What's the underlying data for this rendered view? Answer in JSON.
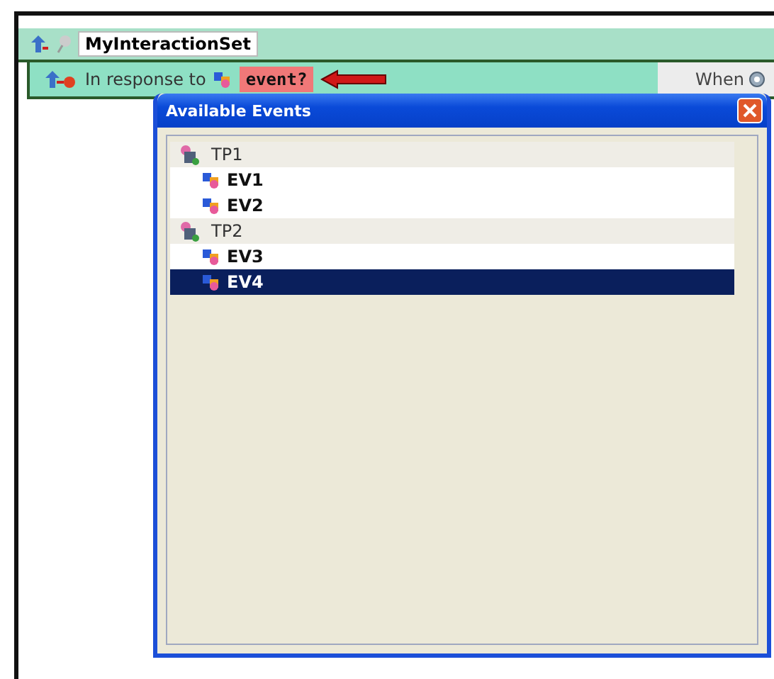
{
  "set": {
    "title": "MyInteractionSet"
  },
  "rule": {
    "prefix": "In response to",
    "event": "event?",
    "when": "When"
  },
  "dialog": {
    "title": "Available Events",
    "groups": [
      {
        "label": "TP1",
        "children": [
          {
            "label": "EV1",
            "selected": false
          },
          {
            "label": "EV2",
            "selected": false
          }
        ]
      },
      {
        "label": "TP2",
        "children": [
          {
            "label": "EV3",
            "selected": false
          },
          {
            "label": "EV4",
            "selected": true
          }
        ]
      }
    ]
  }
}
